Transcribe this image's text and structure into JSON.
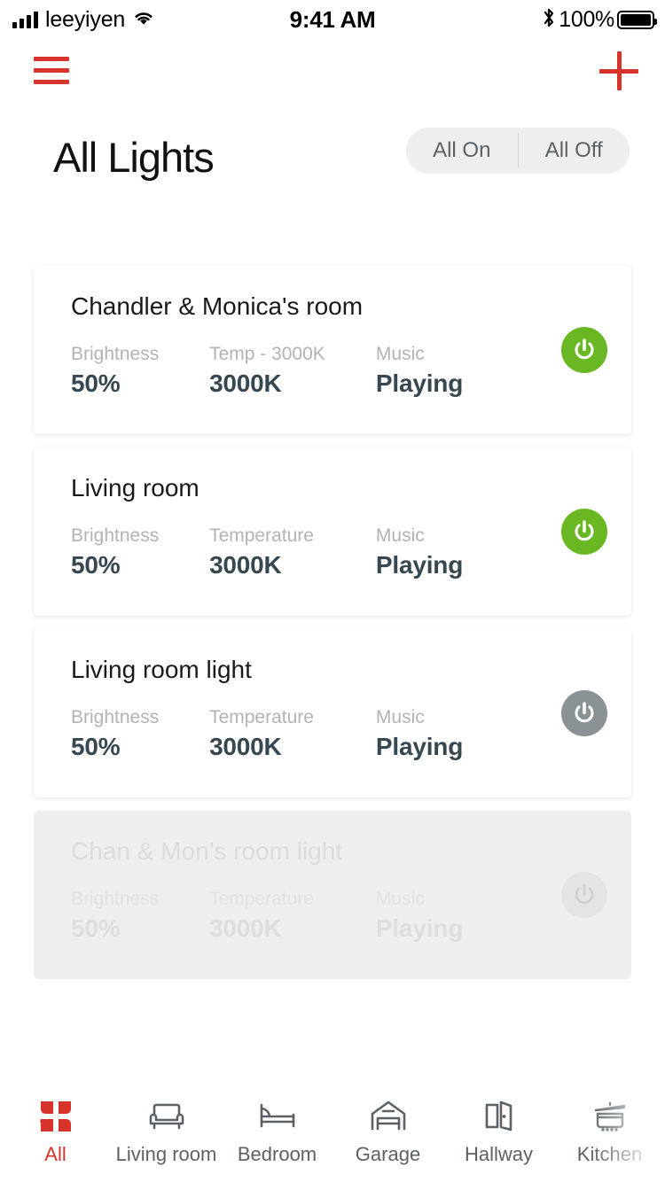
{
  "statusbar": {
    "carrier": "leeyiyen",
    "time": "9:41 AM",
    "battery_percent": "100%",
    "signal_icon": "cellular-bars-icon",
    "wifi_icon": "wifi-icon",
    "bluetooth_icon": "bluetooth-icon",
    "battery_icon": "battery-full-icon"
  },
  "topbar": {
    "menu_icon": "hamburger-menu-icon",
    "add_icon": "plus-icon",
    "accent_color": "#d6342a"
  },
  "header": {
    "title": "All Lights",
    "segmented": {
      "all_on": "All On",
      "all_off": "All Off"
    }
  },
  "labels": {
    "brightness": "Brightness",
    "temperature": "Temperature",
    "temperature_alt": "Temp - 3000K",
    "music": "Music"
  },
  "cards": [
    {
      "title": "Chandler & Monica's room",
      "brightness_label": "Brightness",
      "brightness_value": "50%",
      "temperature_label": "Temp - 3000K",
      "temperature_value": "3000K",
      "music_label": "Music",
      "music_value": "Playing",
      "power_state": "on",
      "power_color": "#68b723",
      "disabled": false
    },
    {
      "title": "Living room",
      "brightness_label": "Brightness",
      "brightness_value": "50%",
      "temperature_label": "Temperature",
      "temperature_value": "3000K",
      "music_label": "Music",
      "music_value": "Playing",
      "power_state": "on",
      "power_color": "#68b723",
      "disabled": false
    },
    {
      "title": "Living room light",
      "brightness_label": "Brightness",
      "brightness_value": "50%",
      "temperature_label": "Temperature",
      "temperature_value": "3000K",
      "music_label": "Music",
      "music_value": "Playing",
      "power_state": "off",
      "power_color": "#8b9296",
      "disabled": false
    },
    {
      "title": "Chan & Mon’s room light",
      "brightness_label": "Brightness",
      "brightness_value": "50%",
      "temperature_label": "Temperature",
      "temperature_value": "3000K",
      "music_label": "Music",
      "music_value": "Playing",
      "power_state": "muted",
      "power_color": "#e4e4e4",
      "disabled": true
    }
  ],
  "bottomnav": {
    "active": "All",
    "items": [
      {
        "label": "All",
        "icon": "grid-squares-icon"
      },
      {
        "label": "Living room",
        "icon": "sofa-icon"
      },
      {
        "label": "Bedroom",
        "icon": "bed-icon"
      },
      {
        "label": "Garage",
        "icon": "garage-icon"
      },
      {
        "label": "Hallway",
        "icon": "door-icon"
      },
      {
        "label": "Kitchen",
        "icon": "cooking-pot-icon"
      }
    ]
  }
}
